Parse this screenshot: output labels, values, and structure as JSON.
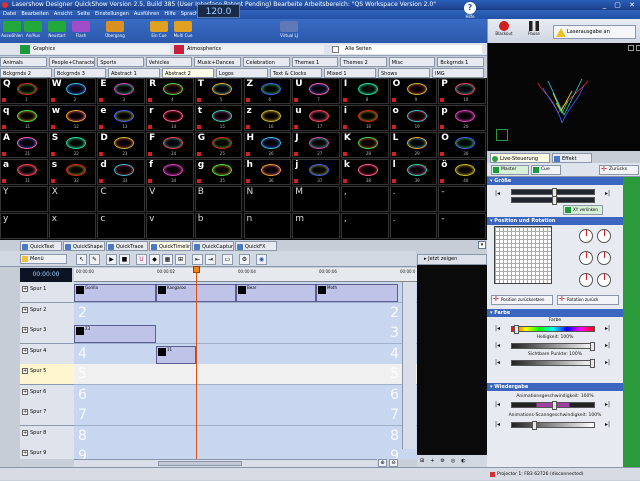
{
  "window": {
    "title": "Lasershow Designer QuickShow   Version 2.5, Build 385  (User Interface Patent Pending)  Bearbeite Arbeitsbereich: \"QS Workspace Version 2.0\"",
    "controls": "_ ▢ ✕"
  },
  "menu": [
    "Datei",
    "Bearbeiten",
    "Ansicht",
    "Seite",
    "Einstellungen",
    "Ausführen",
    "Hilfe",
    "Sprache"
  ],
  "toolbar": {
    "buttons": [
      {
        "label": "Auswählen",
        "color": "#22a83a"
      },
      {
        "label": "An/Aus",
        "color": "#22a83a"
      },
      {
        "label": "Neustart",
        "color": "#22a83a"
      },
      {
        "label": "Flash",
        "color": "#a04cc8"
      },
      {
        "label": "Übergang",
        "color": "#d89020"
      },
      {
        "label": "Ein Cue",
        "color": "#e0a020"
      },
      {
        "label": "Multi Cue",
        "color": "#e0a020"
      },
      {
        "label": "Virtual LJ",
        "color": "#6078b8"
      }
    ],
    "timer": "120.0",
    "help": "Hilfe"
  },
  "right_toolbar": {
    "blackout": "Blackout",
    "pause": "Pause",
    "laser_output": "Laserausgabe an"
  },
  "categories": {
    "graphics": "Graphics",
    "atmospherics": "Atmospherics",
    "all_pages": "Alle Seiten",
    "colors": {
      "graphics": "#1a9a3a",
      "atmospherics": "#c8203a"
    }
  },
  "tabs_row1": [
    "Animals",
    "People+Characters",
    "Sports",
    "Vehicles",
    "Music+Dances",
    "Celebration",
    "Themes 1",
    "Themes 2",
    "Misc",
    "Bckgrnds 1"
  ],
  "tabs_row2": [
    "Bckgrnds 2",
    "Bckgrnds 3",
    "Abstract 1",
    "Abstract 2",
    "Logos",
    "Text & Clocks",
    "Mixed 1",
    "Shows",
    "IMG"
  ],
  "active_tab_row2": 3,
  "grid": {
    "rows": [
      [
        {
          "l": "Q",
          "n": "1"
        },
        {
          "l": "W",
          "n": "2"
        },
        {
          "l": "E",
          "n": "3"
        },
        {
          "l": "R",
          "n": "4"
        },
        {
          "l": "T",
          "n": "5"
        },
        {
          "l": "Z",
          "n": "6"
        },
        {
          "l": "U",
          "n": "7"
        },
        {
          "l": "I",
          "n": "8"
        },
        {
          "l": "O",
          "n": "9"
        },
        {
          "l": "P",
          "n": "10"
        }
      ],
      [
        {
          "l": "q",
          "n": "11"
        },
        {
          "l": "w",
          "n": "12"
        },
        {
          "l": "e",
          "n": "13"
        },
        {
          "l": "r",
          "n": "14"
        },
        {
          "l": "t",
          "n": "15"
        },
        {
          "l": "z",
          "n": "16"
        },
        {
          "l": "u",
          "n": "17"
        },
        {
          "l": "i",
          "n": "18"
        },
        {
          "l": "o",
          "n": "19"
        },
        {
          "l": "p",
          "n": "20"
        }
      ],
      [
        {
          "l": "A",
          "n": "21"
        },
        {
          "l": "S",
          "n": "22"
        },
        {
          "l": "D",
          "n": "23"
        },
        {
          "l": "F",
          "n": "24"
        },
        {
          "l": "G",
          "n": "25"
        },
        {
          "l": "H",
          "n": "26"
        },
        {
          "l": "J",
          "n": "27"
        },
        {
          "l": "K",
          "n": "28"
        },
        {
          "l": "L",
          "n": "29"
        },
        {
          "l": "Ö",
          "n": "30"
        }
      ],
      [
        {
          "l": "a",
          "n": "31"
        },
        {
          "l": "s",
          "n": "32"
        },
        {
          "l": "d",
          "n": "33"
        },
        {
          "l": "f",
          "n": "34"
        },
        {
          "l": "g",
          "n": "35"
        },
        {
          "l": "h",
          "n": "36"
        },
        {
          "l": "j",
          "n": "37"
        },
        {
          "l": "k",
          "n": "38"
        },
        {
          "l": "l",
          "n": "39"
        },
        {
          "l": "ö",
          "n": "40"
        }
      ],
      [
        {
          "l": "Y",
          "n": ""
        },
        {
          "l": "X",
          "n": ""
        },
        {
          "l": "C",
          "n": ""
        },
        {
          "l": "V",
          "n": ""
        },
        {
          "l": "B",
          "n": ""
        },
        {
          "l": "N",
          "n": ""
        },
        {
          "l": "M",
          "n": ""
        },
        {
          "l": ",",
          "n": ""
        },
        {
          "l": ".",
          "n": ""
        },
        {
          "l": "-",
          "n": ""
        }
      ],
      [
        {
          "l": "y",
          "n": ""
        },
        {
          "l": "x",
          "n": ""
        },
        {
          "l": "c",
          "n": ""
        },
        {
          "l": "v",
          "n": ""
        },
        {
          "l": "b",
          "n": ""
        },
        {
          "l": "n",
          "n": ""
        },
        {
          "l": "m",
          "n": ""
        },
        {
          "l": ",",
          "n": ""
        },
        {
          "l": ".",
          "n": ""
        },
        {
          "l": "-",
          "n": ""
        }
      ]
    ],
    "palette": [
      "#e02020",
      "#30c0e0",
      "#e040c0",
      "#40e040",
      "#f0a020",
      "#4060ff",
      "#ff60a0",
      "#20e0a0",
      "#c0c020",
      "#ff4040"
    ]
  },
  "bottom_tabs": [
    "QuickText",
    "QuickShape",
    "QuickTrace",
    "QuickTimeline",
    "QuickCapture",
    "QuickFX"
  ],
  "active_bottom_tab": 3,
  "timeline": {
    "menu": "Menü",
    "clock": "00:00:00",
    "ticks": [
      "00:00:00",
      "00:00:02",
      "00:00:04",
      "00:00:06",
      "00:00:0"
    ],
    "tracks": [
      "Spur 1",
      "Spur 2",
      "Spur 3",
      "Spur 4",
      "Spur 5",
      "Spur 6",
      "Spur 7",
      "Spur 8",
      "Spur 9"
    ],
    "active_track": 4,
    "lane_numbers": [
      "1",
      "2",
      "3",
      "4",
      "5",
      "6",
      "7",
      "8",
      "9"
    ],
    "clips": [
      {
        "track": 0,
        "name": "Gorilla"
      },
      {
        "track": 0,
        "name": "Kangaroo"
      },
      {
        "track": 0,
        "name": "Bear"
      },
      {
        "track": 0,
        "name": "Moth"
      },
      {
        "track": 2,
        "name": "23"
      },
      {
        "track": 3,
        "name": "11"
      }
    ],
    "preview_header": "Jetzt zeigen"
  },
  "right_panel": {
    "tabs": [
      "Live-Steuerung",
      "Effekt"
    ],
    "sub_buttons": [
      "Master",
      "Cue"
    ],
    "back": "Zurücks",
    "size_section": "Größe",
    "linked": "XY verlinken",
    "pos_section": "Position und Rotation",
    "pos_reset": "Position zurücksetzen",
    "rot_reset": "Rotation zurück",
    "color_section": "Farbe",
    "color_label": "Farbe",
    "brightness": "Helligkeit: 100%",
    "visible_points": "Sichtbare Punkte: 100%",
    "playback_section": "Wiedergabe",
    "anim_speed": "Animationsgeschwindigkeit: 100%",
    "scan_speed": "Animations-Scanngeschwindigkeit: 100%",
    "status": "Projector 1: FB3 62726 (disconnected)"
  }
}
